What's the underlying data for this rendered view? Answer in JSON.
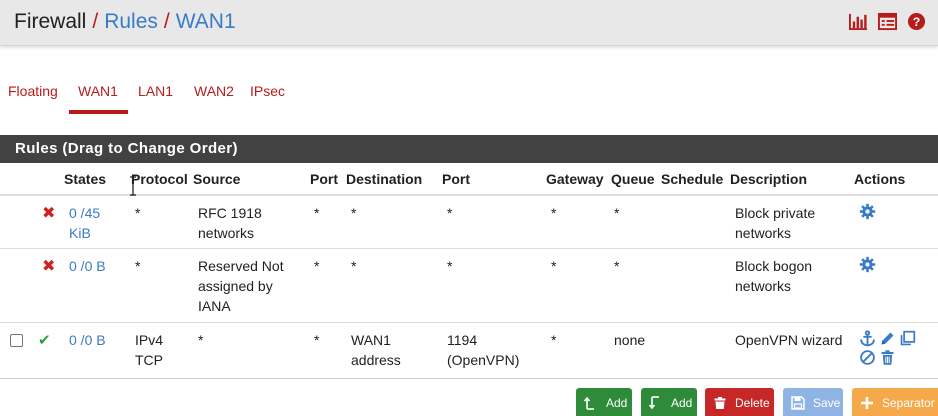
{
  "header": {
    "crumbs": [
      "Firewall",
      "Rules",
      "WAN1"
    ],
    "sep": "/",
    "icons": [
      "bar-chart-icon",
      "table-list-icon",
      "help-icon"
    ]
  },
  "tabs": [
    {
      "label": "Floating",
      "active": false
    },
    {
      "label": "WAN1",
      "active": true
    },
    {
      "label": "LAN1",
      "active": false
    },
    {
      "label": "WAN2",
      "active": false
    },
    {
      "label": "IPsec",
      "active": false
    }
  ],
  "panel": {
    "title": "Rules (Drag to Change Order)"
  },
  "table": {
    "columns": [
      "States",
      "Protocol",
      "Source",
      "Port",
      "Destination",
      "Port",
      "Gateway",
      "Queue",
      "Schedule",
      "Description",
      "Actions"
    ],
    "rows": [
      {
        "status": "block",
        "states": "0 /45 KiB",
        "protocol": "*",
        "source": "RFC 1918 networks",
        "src_port": "*",
        "destination": "*",
        "dst_port": "*",
        "gateway": "*",
        "queue": "*",
        "schedule": "",
        "description": "Block private networks",
        "actions": [
          "gear-icon"
        ]
      },
      {
        "status": "block",
        "states": "0 /0 B",
        "protocol": "*",
        "source": "Reserved Not assigned by IANA",
        "src_port": "*",
        "destination": "*",
        "dst_port": "*",
        "gateway": "*",
        "queue": "*",
        "schedule": "",
        "description": "Block bogon networks",
        "actions": [
          "gear-icon"
        ]
      },
      {
        "status": "pass",
        "states": "0 /0 B",
        "protocol": "IPv4 TCP",
        "source": "*",
        "src_port": "*",
        "destination": "WAN1 address",
        "dst_port": "1194 (OpenVPN)",
        "gateway": "*",
        "queue": "none",
        "schedule": "",
        "description": "OpenVPN wizard",
        "actions": [
          "anchor-icon",
          "pencil-icon",
          "copy-icon",
          "disable-icon",
          "trash-icon"
        ]
      }
    ],
    "status_symbols": {
      "block": "✖",
      "pass": "✔"
    }
  },
  "buttons": {
    "add_top": "Add",
    "add_bottom": "Add",
    "delete": "Delete",
    "save": "Save",
    "separator": "Separator"
  },
  "colors": {
    "brand_red": "#b71c1c",
    "link_blue": "#3a7bc8",
    "panel_dark": "#424242",
    "add_green": "#2e8b3a",
    "delete_red": "#c62828",
    "save_blue": "#8fb4e3",
    "separator_orange": "#f5a94a"
  }
}
